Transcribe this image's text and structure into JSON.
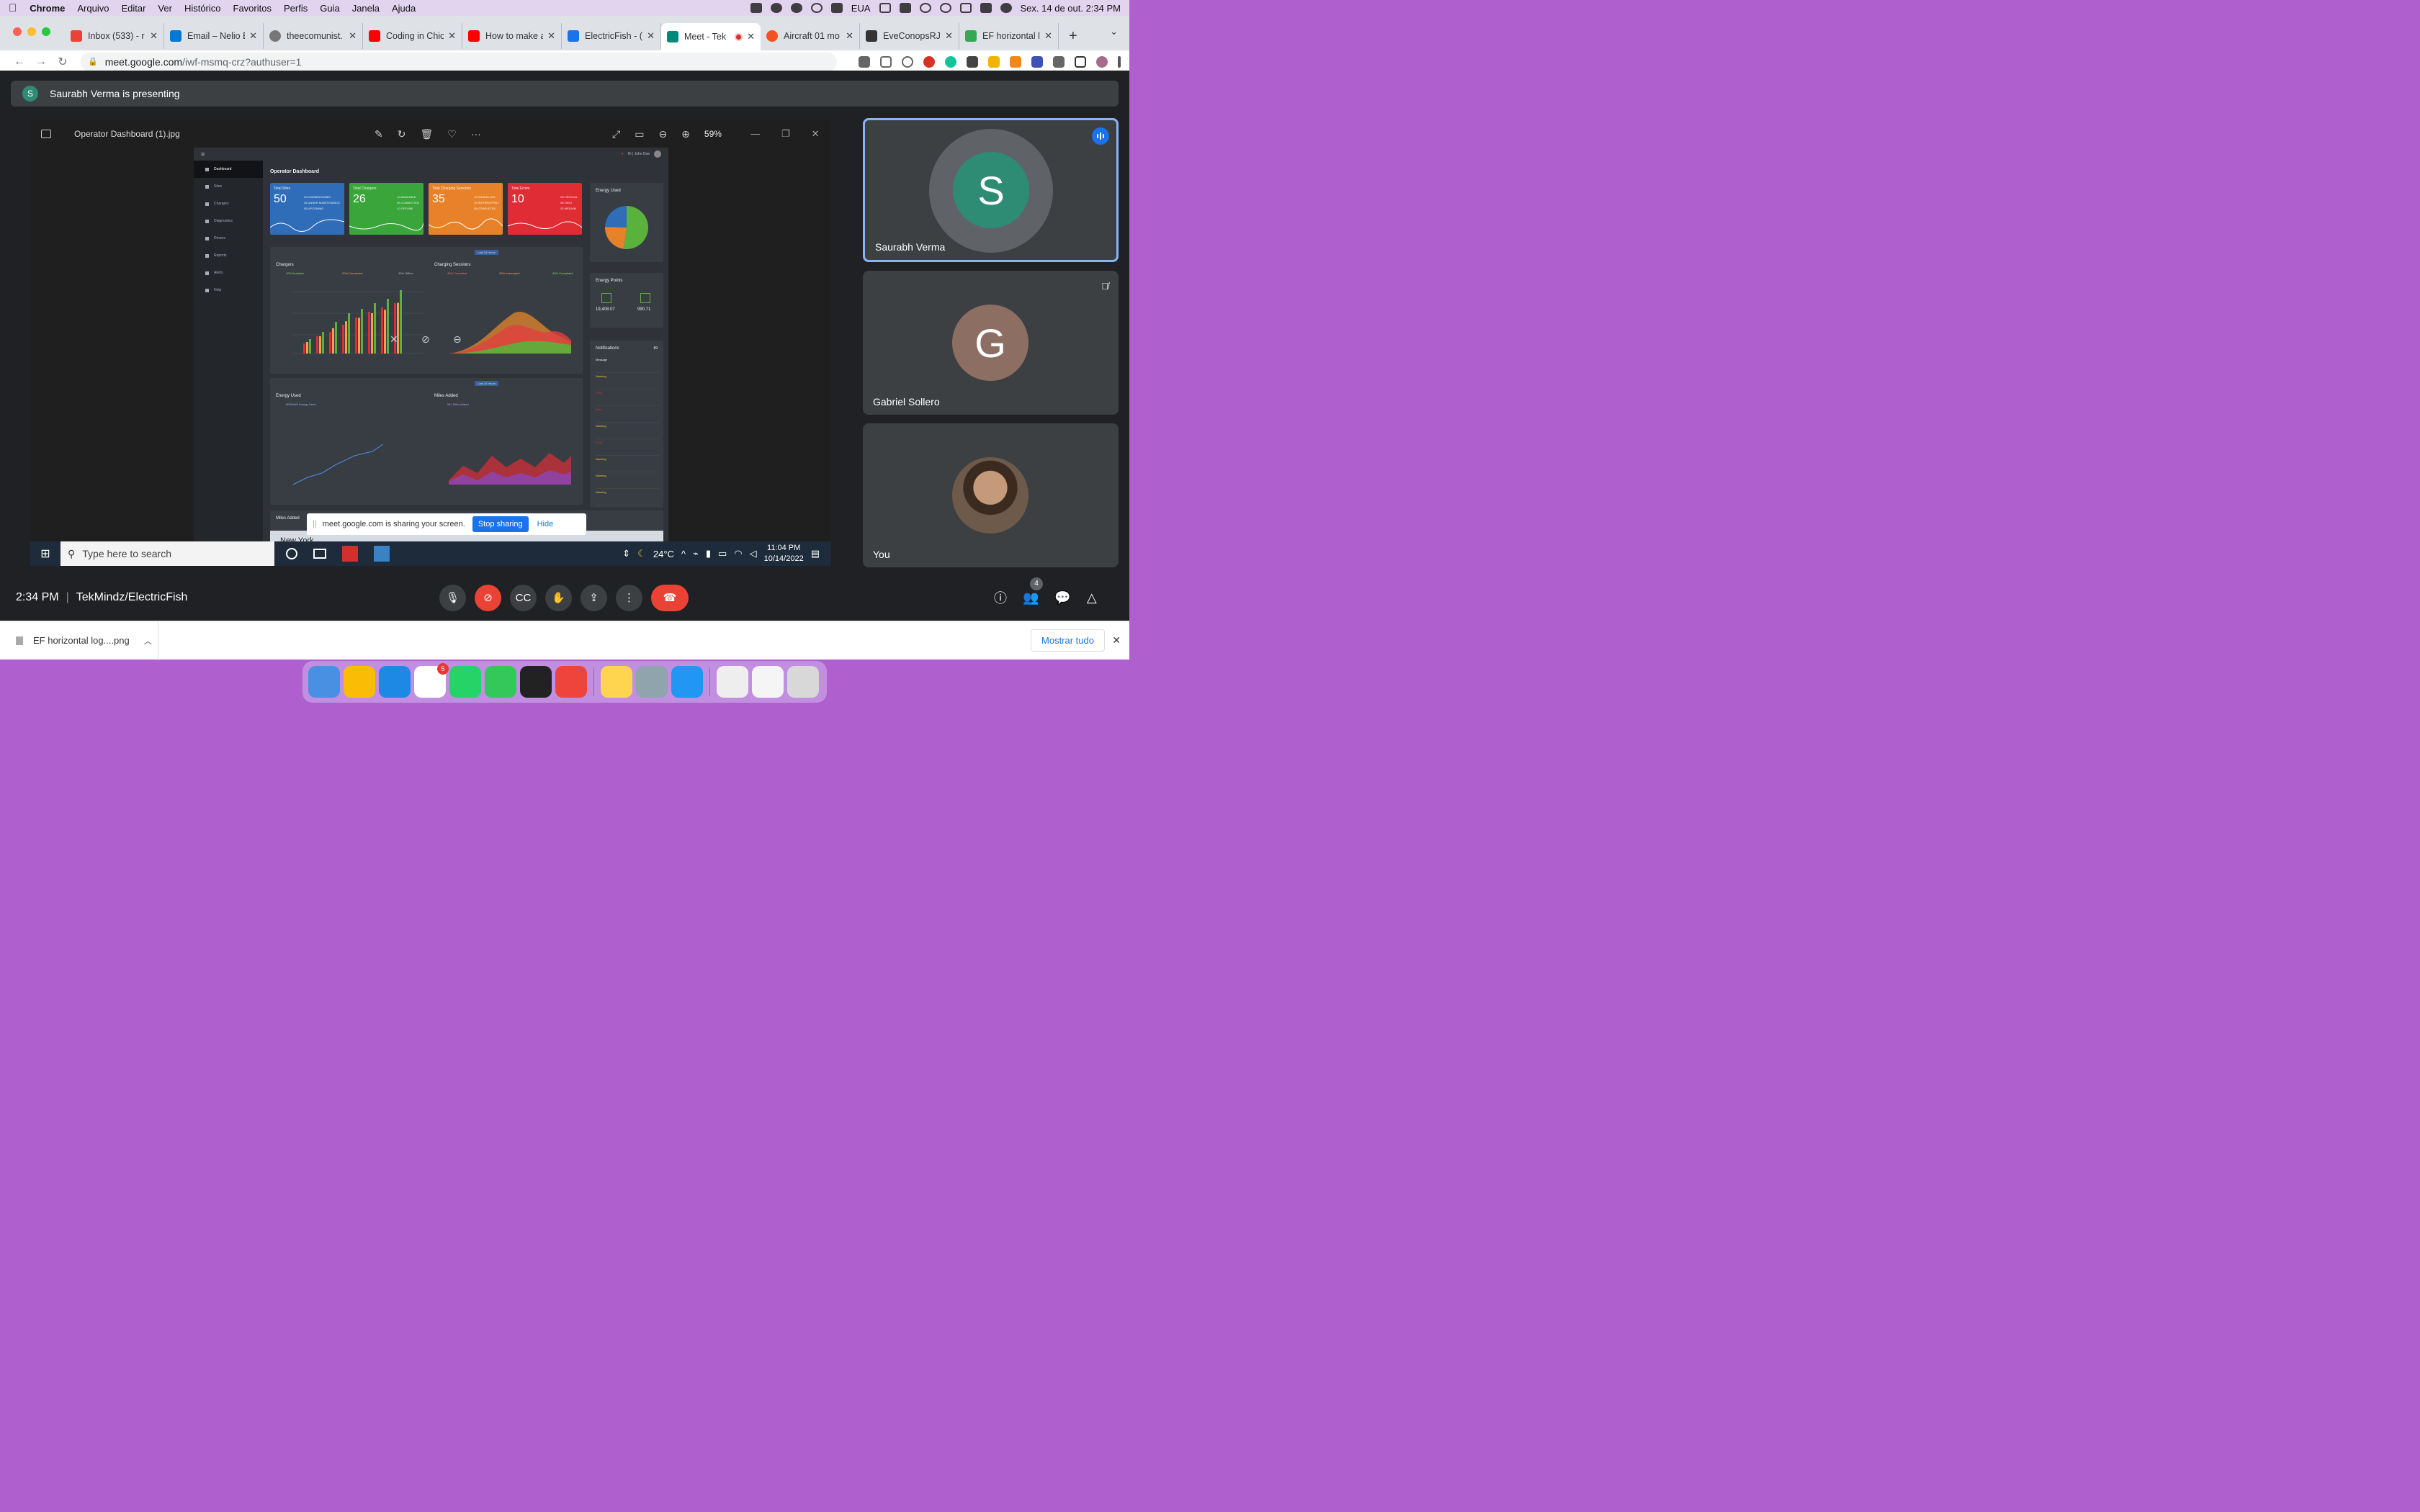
{
  "menubar": {
    "app": "Chrome",
    "items": [
      "Arquivo",
      "Editar",
      "Ver",
      "Histórico",
      "Favoritos",
      "Perfis",
      "Guia",
      "Janela",
      "Ajuda"
    ],
    "input_source": "EUA",
    "clock": "Sex. 14 de out.  2:34 PM"
  },
  "tabs": [
    {
      "label": "Inbox (533) - r",
      "color": "#ea4335"
    },
    {
      "label": "Email – Nelio E",
      "color": "#0078d4"
    },
    {
      "label": "theecomunist.",
      "color": "#777777"
    },
    {
      "label": "Coding in Chic",
      "color": "#ff0000"
    },
    {
      "label": "How to make a",
      "color": "#ff0000"
    },
    {
      "label": "ElectricFish - (",
      "color": "#1a73e8"
    },
    {
      "label": "Meet - Tek",
      "color": "#00897b"
    },
    {
      "label": "Aircraft 01 mo",
      "color": "#f4511e"
    },
    {
      "label": "EveConopsRJ",
      "color": "#333333"
    },
    {
      "label": "EF horizontal l",
      "color": "#34a853"
    }
  ],
  "omnibox": {
    "host": "meet.google.com",
    "path": "/iwf-msmq-crz?authuser=1"
  },
  "presenting": {
    "initial": "S",
    "text": "Saurabh Verma is presenting"
  },
  "viewer": {
    "filename": "Operator Dashboard (1).jpg",
    "zoom": "59%"
  },
  "dashboard": {
    "title": "Operator Dashboard",
    "user": "Hi | John Doe",
    "nav": [
      "Dashboard",
      "Sites",
      "Chargers",
      "Diagnostics",
      "Drivers",
      "Reports",
      "Alerts",
      "Help"
    ],
    "kpis": [
      {
        "label": "Total Sites",
        "value": "50",
        "color": "#2f6db8",
        "lines": [
          "20 COMMISSIONED",
          "25 UNDER MAINTENANCE",
          "05 UPCOMING"
        ]
      },
      {
        "label": "Total Chargers",
        "value": "26",
        "color": "#3aa53a",
        "lines": [
          "10 AVAILABLE",
          "06 CONNECTED",
          "10 OFFLINE"
        ]
      },
      {
        "label": "Total Charging Sessions",
        "value": "35",
        "color": "#e8822a",
        "lines": [
          "15 CANCELLED",
          "15 INTERRUPTED",
          "05 COMPLETED"
        ]
      },
      {
        "label": "Total Errors",
        "value": "10",
        "color": "#e02d35",
        "lines": [
          "03 CRITICAL",
          "05 HIGH",
          "02 MEDIUM"
        ]
      }
    ],
    "energy_used": {
      "title": "Energy Used",
      "slices": [
        {
          "value": 990.71,
          "color": "#5ab23c"
        },
        {
          "value": 441.73,
          "color": "#e8822a"
        },
        {
          "value": 466.07,
          "color": "#2f6db8"
        }
      ]
    },
    "energy_points": {
      "title": "Energy Points",
      "a": "19,408.07",
      "b": "990.71"
    },
    "notifications": {
      "title": "Notifications",
      "count": "89",
      "items": [
        "Message",
        "Warning",
        "Error",
        "Error",
        "Warning",
        "Error",
        "Warning",
        "Warning",
        "Warning"
      ]
    },
    "chargers": {
      "title": "Chargers",
      "legend": [
        "40% Available",
        "20% Connected",
        "40% Offline"
      ],
      "tag": ""
    },
    "charging_sessions": {
      "title": "Charging Sessions",
      "legend": [
        "45% Cancelled",
        "25% Interrupted",
        "40% Completed"
      ],
      "tag": "Last 24 Hours"
    },
    "energy_used_panel": {
      "title": "Energy Used",
      "legend": [
        "8000kWh Energy Used"
      ]
    },
    "miles_added": {
      "title": "Miles Added",
      "legend": [
        "567 Miles Added"
      ],
      "tag": "Last 24 Hours"
    },
    "miles_added_bottom": "Miles Added",
    "map_label": "New York"
  },
  "share_banner": {
    "text": "meet.google.com is sharing your screen.",
    "stop": "Stop sharing",
    "hide": "Hide"
  },
  "windows_taskbar": {
    "search_placeholder": "Type here to search",
    "temp": "24°C",
    "time": "11:04 PM",
    "date": "10/14/2022"
  },
  "participants": [
    {
      "name": "Saurabh Verma",
      "initial": "S",
      "color": "#2e8b74",
      "speaking": true
    },
    {
      "name": "Gabriel Sollero",
      "initial": "G",
      "color": "#8d6e63",
      "muted": true
    },
    {
      "name": "You",
      "initial": "",
      "color": "#6d5a4b"
    }
  ],
  "meeting": {
    "time": "2:34 PM",
    "code": "TekMindz/ElectricFish",
    "people_count": "4"
  },
  "download": {
    "file": "EF horizontal log....png",
    "show_all": "Mostrar tudo"
  },
  "dock": {
    "apps": [
      {
        "name": "finder",
        "color": "#4a90e2"
      },
      {
        "name": "chrome",
        "color": "#fbbc05"
      },
      {
        "name": "vscode",
        "color": "#1e88e5"
      },
      {
        "name": "slack",
        "color": "#ffffff",
        "badge": "5"
      },
      {
        "name": "whatsapp",
        "color": "#25d366"
      },
      {
        "name": "facetime",
        "color": "#34c759"
      },
      {
        "name": "terminal",
        "color": "#222222"
      },
      {
        "name": "anydesk",
        "color": "#ef443b"
      },
      {
        "name": "notes",
        "color": "#ffd54f"
      },
      {
        "name": "preview",
        "color": "#90a4ae"
      },
      {
        "name": "safari",
        "color": "#2196f3"
      },
      {
        "name": "window-thumb-1",
        "color": "#eeeeee"
      },
      {
        "name": "window-thumb-2",
        "color": "#f5f5f5"
      },
      {
        "name": "trash",
        "color": "#d8d8d8"
      }
    ]
  }
}
